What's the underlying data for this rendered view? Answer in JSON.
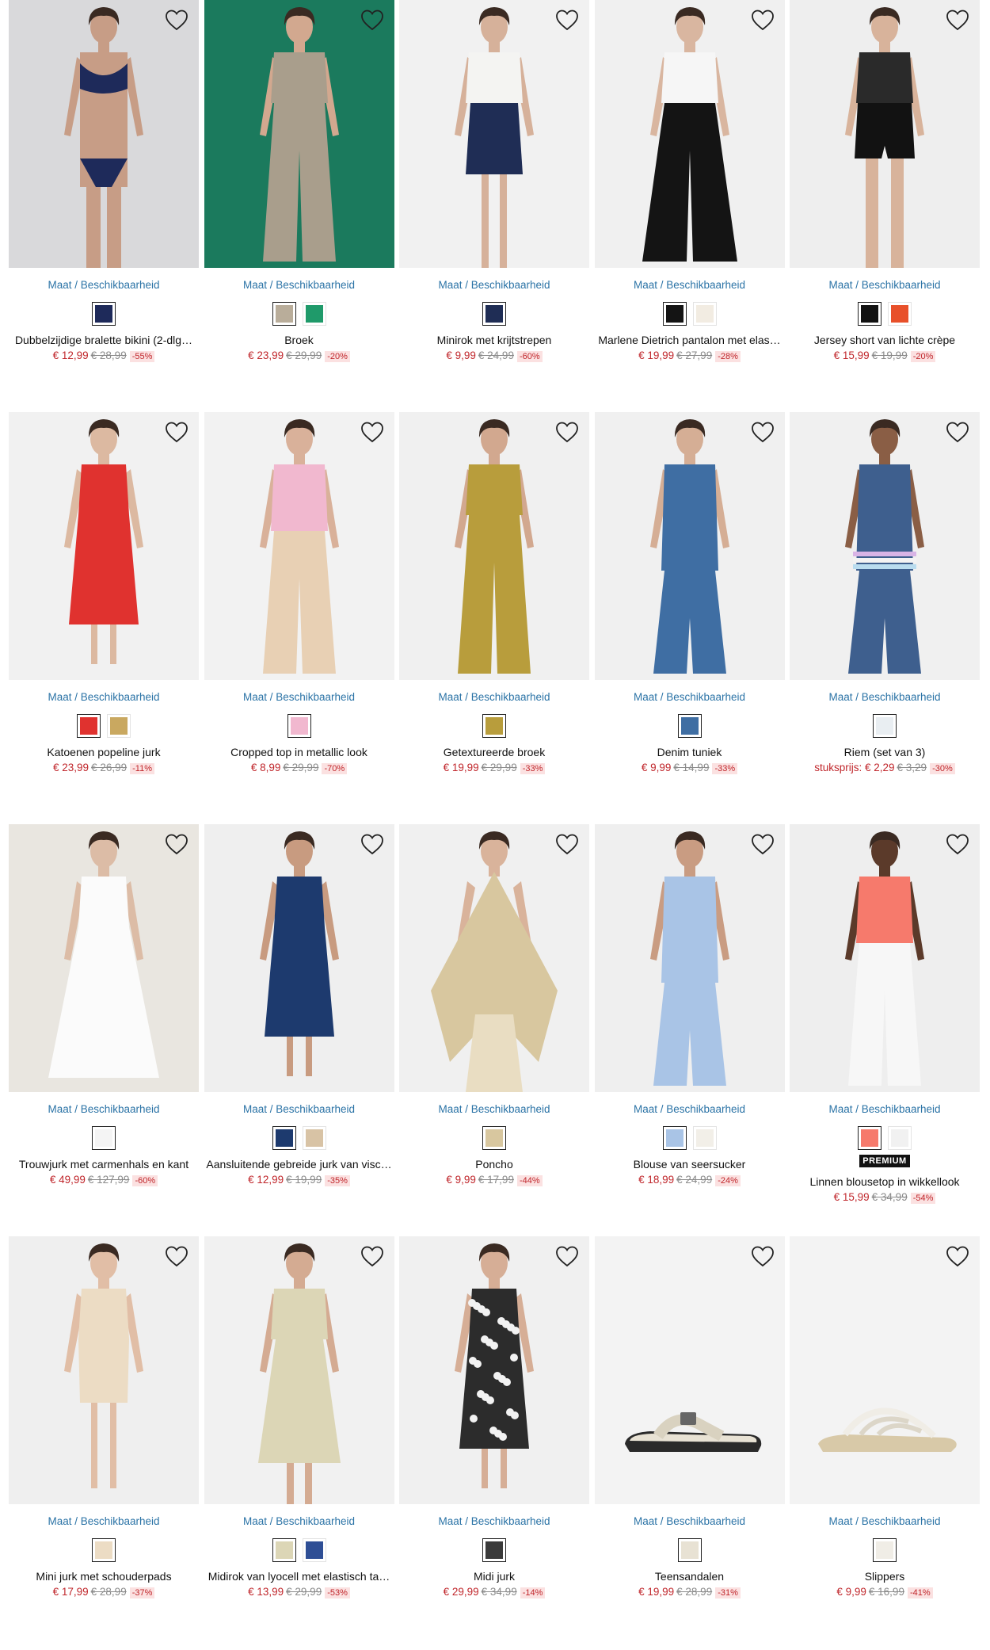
{
  "theme": {
    "link": "#2b73a6",
    "sale": "#c0262b",
    "sale_bg": "#fbe1e1",
    "old": "#8a8a8a"
  },
  "products": [
    {
      "name": "Dubbelzijdige bralette bikini (2-dlg…",
      "size_link": "Maat / Beschikbaarheid",
      "price_prefix": "",
      "price": "€ 12,99",
      "old_price": "€ 28,99",
      "discount": "-55%",
      "badge": "",
      "wishlist_icon": "heart-outline-icon",
      "photo": {
        "bg": "#d9d9db",
        "skin": "#c79d86",
        "top": "#1e2a5a",
        "bottom": "#1e2a5a",
        "style": "bikini"
      },
      "swatches": [
        {
          "color": "#1e2a5a",
          "selected": true
        }
      ]
    },
    {
      "name": "Broek",
      "size_link": "Maat / Beschikbaarheid",
      "price_prefix": "",
      "price": "€ 23,99",
      "old_price": "€ 29,99",
      "discount": "-20%",
      "badge": "",
      "wishlist_icon": "heart-outline-icon",
      "photo": {
        "bg": "#1b7a5d",
        "skin": "#d2a88f",
        "top": "#a99e8c",
        "bottom": "#a99e8c",
        "style": "pants"
      },
      "swatches": [
        {
          "color": "#b9ad9a",
          "selected": true
        },
        {
          "color": "#1f9a6a",
          "selected": false
        }
      ]
    },
    {
      "name": "Minirok met krijtstrepen",
      "size_link": "Maat / Beschikbaarheid",
      "price_prefix": "",
      "price": "€ 9,99",
      "old_price": "€ 24,99",
      "discount": "-60%",
      "badge": "",
      "wishlist_icon": "heart-outline-icon",
      "photo": {
        "bg": "#f1f1f1",
        "skin": "#d6b19a",
        "top": "#f4f4f2",
        "bottom": "#1f2d55",
        "style": "skirt"
      },
      "swatches": [
        {
          "color": "#1f2d55",
          "selected": true
        }
      ]
    },
    {
      "name": "Marlene Dietrich pantalon met elas…",
      "size_link": "Maat / Beschikbaarheid",
      "price_prefix": "",
      "price": "€ 19,99",
      "old_price": "€ 27,99",
      "discount": "-28%",
      "badge": "",
      "wishlist_icon": "heart-outline-icon",
      "photo": {
        "bg": "#f0f0f0",
        "skin": "#d9b6a0",
        "top": "#f6f6f6",
        "bottom": "#141414",
        "style": "wide"
      },
      "swatches": [
        {
          "color": "#141414",
          "selected": true
        },
        {
          "color": "#f2ece2",
          "selected": false
        }
      ]
    },
    {
      "name": "Jersey short van lichte crèpe",
      "size_link": "Maat / Beschikbaarheid",
      "price_prefix": "",
      "price": "€ 15,99",
      "old_price": "€ 19,99",
      "discount": "-20%",
      "badge": "",
      "wishlist_icon": "heart-outline-icon",
      "photo": {
        "bg": "#eeeeee",
        "skin": "#d8b39b",
        "top": "#2a2a2a",
        "bottom": "#121212",
        "style": "shorts"
      },
      "swatches": [
        {
          "color": "#121212",
          "selected": true
        },
        {
          "color": "#e8502a",
          "selected": false
        }
      ]
    },
    {
      "name": "Katoenen popeline jurk",
      "size_link": "Maat / Beschikbaarheid",
      "price_prefix": "",
      "price": "€ 23,99",
      "old_price": "€ 26,99",
      "discount": "-11%",
      "badge": "",
      "wishlist_icon": "heart-outline-icon",
      "photo": {
        "bg": "#f1f1f1",
        "skin": "#dcb9a1",
        "top": "#e0322f",
        "bottom": "#e0322f",
        "style": "dress"
      },
      "swatches": [
        {
          "color": "#e0322f",
          "selected": true
        },
        {
          "color": "#c9a860",
          "selected": false
        }
      ]
    },
    {
      "name": "Cropped top in metallic look",
      "size_link": "Maat / Beschikbaarheid",
      "price_prefix": "",
      "price": "€ 8,99",
      "old_price": "€ 29,99",
      "discount": "-70%",
      "badge": "",
      "wishlist_icon": "heart-outline-icon",
      "photo": {
        "bg": "#f2f2f2",
        "skin": "#d9b19a",
        "top": "#f1b8cf",
        "bottom": "#e8d0b4",
        "style": "top"
      },
      "swatches": [
        {
          "color": "#f1b8cf",
          "selected": true
        }
      ]
    },
    {
      "name": "Getextureerde broek",
      "size_link": "Maat / Beschikbaarheid",
      "price_prefix": "",
      "price": "€ 19,99",
      "old_price": "€ 29,99",
      "discount": "-33%",
      "badge": "",
      "wishlist_icon": "heart-outline-icon",
      "photo": {
        "bg": "#f0f0f0",
        "skin": "#d2a88f",
        "top": "#b89d3c",
        "bottom": "#b89d3c",
        "style": "pants"
      },
      "swatches": [
        {
          "color": "#b89d3c",
          "selected": true
        }
      ]
    },
    {
      "name": "Denim tuniek",
      "size_link": "Maat / Beschikbaarheid",
      "price_prefix": "",
      "price": "€ 9,99",
      "old_price": "€ 14,99",
      "discount": "-33%",
      "badge": "",
      "wishlist_icon": "heart-outline-icon",
      "photo": {
        "bg": "#f0f0f0",
        "skin": "#d5ae95",
        "top": "#3f6ea3",
        "bottom": "#3f6ea3",
        "style": "tunic"
      },
      "swatches": [
        {
          "color": "#3f6ea3",
          "selected": true
        }
      ]
    },
    {
      "name": "Riem (set van 3)",
      "size_link": "Maat / Beschikbaarheid",
      "price_prefix": "stuksprijs: ",
      "price": "€ 2,29",
      "old_price": "€ 3,29",
      "discount": "-30%",
      "badge": "",
      "wishlist_icon": "heart-outline-icon",
      "photo": {
        "bg": "#f0f0f0",
        "skin": "#8a5e45",
        "top": "#3e5f8e",
        "bottom": "#3e5f8e",
        "style": "belt"
      },
      "swatches": [
        {
          "color": "#e9eef2",
          "selected": true
        }
      ]
    },
    {
      "name": "Trouwjurk met carmenhals en kant",
      "size_link": "Maat / Beschikbaarheid",
      "price_prefix": "",
      "price": "€ 49,99",
      "old_price": "€ 127,99",
      "discount": "-60%",
      "badge": "",
      "wishlist_icon": "heart-outline-icon",
      "photo": {
        "bg": "#e9e6e0",
        "skin": "#dcbca6",
        "top": "#fbfbfb",
        "bottom": "#fbfbfb",
        "style": "gown"
      },
      "swatches": [
        {
          "color": "#f4f4f4",
          "selected": true
        }
      ]
    },
    {
      "name": "Aansluitende gebreide jurk van visc…",
      "size_link": "Maat / Beschikbaarheid",
      "price_prefix": "",
      "price": "€ 12,99",
      "old_price": "€ 19,99",
      "discount": "-35%",
      "badge": "",
      "wishlist_icon": "heart-outline-icon",
      "photo": {
        "bg": "#efefef",
        "skin": "#c89b80",
        "top": "#1d3a6e",
        "bottom": "#1d3a6e",
        "style": "dress"
      },
      "swatches": [
        {
          "color": "#1d3a6e",
          "selected": true
        },
        {
          "color": "#d8c3a5",
          "selected": false
        }
      ]
    },
    {
      "name": "Poncho",
      "size_link": "Maat / Beschikbaarheid",
      "price_prefix": "",
      "price": "€ 9,99",
      "old_price": "€ 17,99",
      "discount": "-44%",
      "badge": "",
      "wishlist_icon": "heart-outline-icon",
      "photo": {
        "bg": "#f0f0f0",
        "skin": "#d9b39b",
        "top": "#d8c79f",
        "bottom": "#e9ddc2",
        "style": "poncho"
      },
      "swatches": [
        {
          "color": "#d8c79f",
          "selected": true
        }
      ]
    },
    {
      "name": "Blouse van seersucker",
      "size_link": "Maat / Beschikbaarheid",
      "price_prefix": "",
      "price": "€ 18,99",
      "old_price": "€ 24,99",
      "discount": "-24%",
      "badge": "",
      "wishlist_icon": "heart-outline-icon",
      "photo": {
        "bg": "#efefef",
        "skin": "#c99c82",
        "top": "#a9c4e6",
        "bottom": "#a9c4e6",
        "style": "tunic"
      },
      "swatches": [
        {
          "color": "#a9c4e6",
          "selected": true
        },
        {
          "color": "#f2efe8",
          "selected": false
        }
      ]
    },
    {
      "name": "Linnen blousetop in wikkellook",
      "size_link": "Maat / Beschikbaarheid",
      "price_prefix": "",
      "price": "€ 15,99",
      "old_price": "€ 34,99",
      "discount": "-54%",
      "badge": "PREMIUM",
      "wishlist_icon": "heart-outline-icon",
      "photo": {
        "bg": "#eeeeee",
        "skin": "#5b3a2a",
        "top": "#f67a6c",
        "bottom": "#f7f7f7",
        "style": "top"
      },
      "swatches": [
        {
          "color": "#f67a6c",
          "selected": true
        },
        {
          "color": "#f1f1f1",
          "selected": false
        }
      ]
    },
    {
      "name": "Mini jurk met schouderpads",
      "size_link": "Maat / Beschikbaarheid",
      "price_prefix": "",
      "price": "€ 17,99",
      "old_price": "€ 28,99",
      "discount": "-37%",
      "badge": "",
      "wishlist_icon": "heart-outline-icon",
      "photo": {
        "bg": "#efefef",
        "skin": "#e1bea6",
        "top": "#ecdcc4",
        "bottom": "#ecdcc4",
        "style": "mini"
      },
      "swatches": [
        {
          "color": "#ecdcc4",
          "selected": true
        }
      ]
    },
    {
      "name": "Midirok van lyocell met elastisch ta…",
      "size_link": "Maat / Beschikbaarheid",
      "price_prefix": "",
      "price": "€ 13,99",
      "old_price": "€ 29,99",
      "discount": "-53%",
      "badge": "",
      "wishlist_icon": "heart-outline-icon",
      "photo": {
        "bg": "#f1f1f1",
        "skin": "#d4ab92",
        "top": "#dcd6b6",
        "bottom": "#dcd6b6",
        "style": "midi"
      },
      "swatches": [
        {
          "color": "#dcd6b6",
          "selected": true
        },
        {
          "color": "#2e4e95",
          "selected": false
        }
      ]
    },
    {
      "name": "Midi jurk",
      "size_link": "Maat / Beschikbaarheid",
      "price_prefix": "",
      "price": "€ 29,99",
      "old_price": "€ 34,99",
      "discount": "-14%",
      "badge": "",
      "wishlist_icon": "heart-outline-icon",
      "photo": {
        "bg": "#f0f0f0",
        "skin": "#d6ae96",
        "top": "#2c2c2c",
        "bottom": "#e9e9e9",
        "style": "print"
      },
      "swatches": [
        {
          "color": "#3a3a3a",
          "selected": true
        }
      ]
    },
    {
      "name": "Teensandalen",
      "size_link": "Maat / Beschikbaarheid",
      "price_prefix": "",
      "price": "€ 19,99",
      "old_price": "€ 28,99",
      "discount": "-31%",
      "badge": "",
      "wishlist_icon": "heart-outline-icon",
      "photo": {
        "bg": "#f3f3f3",
        "skin": "#e8e2d4",
        "top": "#e8e2d4",
        "bottom": "#2a2a2a",
        "style": "sandal"
      },
      "swatches": [
        {
          "color": "#e8e2d4",
          "selected": true
        }
      ]
    },
    {
      "name": "Slippers",
      "size_link": "Maat / Beschikbaarheid",
      "price_prefix": "",
      "price": "€ 9,99",
      "old_price": "€ 16,99",
      "discount": "-41%",
      "badge": "",
      "wishlist_icon": "heart-outline-icon",
      "photo": {
        "bg": "#f3f3f3",
        "skin": "#f0ede6",
        "top": "#f0ede6",
        "bottom": "#d8c9a8",
        "style": "slipper"
      },
      "swatches": [
        {
          "color": "#f0ede6",
          "selected": true
        }
      ]
    }
  ]
}
